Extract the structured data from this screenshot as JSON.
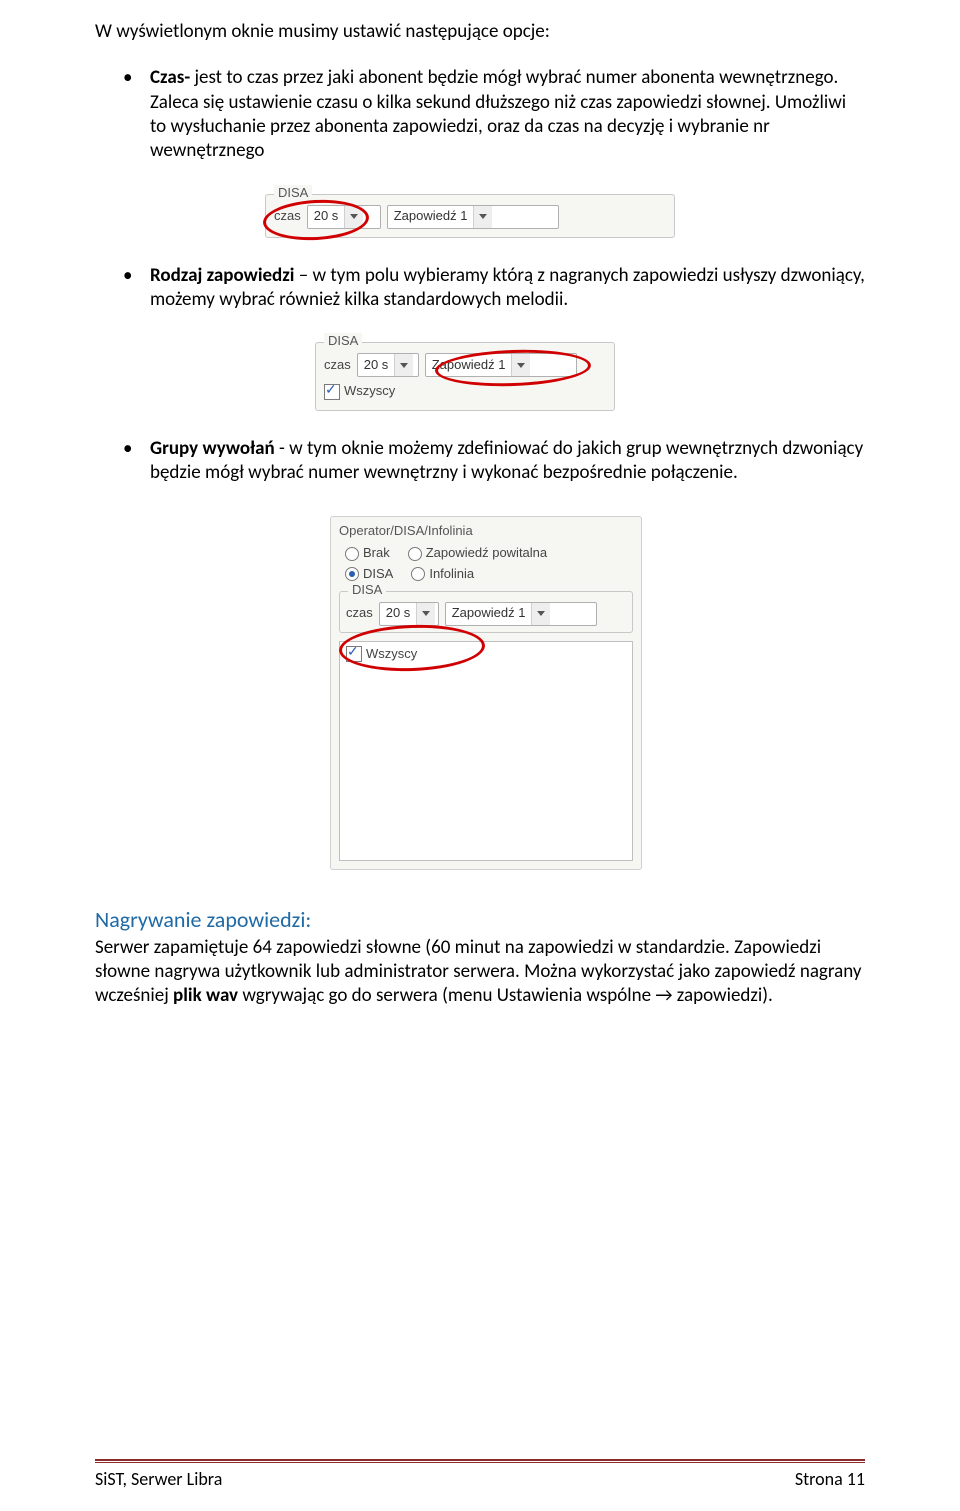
{
  "intro": "W wyświetlonym oknie musimy ustawić następujące opcje:",
  "bullet1": {
    "lead": "Czas-",
    "text": " jest to czas przez jaki abonent będzie mógł wybrać numer abonenta wewnętrznego. Zaleca się ustawienie czasu o kilka sekund dłuższego niż czas zapowiedzi słownej. Umożliwi to wysłuchanie  przez abonenta zapowiedzi, oraz da czas na decyzję i wybranie nr wewnętrznego"
  },
  "bullet2": {
    "lead": "Rodzaj zapowiedzi",
    "text": " – w tym polu wybieramy którą z nagranych zapowiedzi usłyszy dzwoniący, możemy wybrać również kilka standardowych melodii."
  },
  "bullet3": {
    "lead": "Grupy wywołań",
    "text": " -  w tym oknie możemy zdefiniować do jakich grup wewnętrznych dzwoniący będzie mógł wybrać numer wewnętrzny i wykonać bezpośrednie połączenie."
  },
  "shots": {
    "disa_legend": "DISA",
    "czas_label": "czas",
    "czas_value": "20 s",
    "zap_value": "Zapowiedź 1",
    "wszyscy_label": "Wszyscy",
    "operator_title": "Operator/DISA/Infolinia",
    "radio_brak": "Brak",
    "radio_zap_powitalna": "Zapowiedź powitalna",
    "radio_disa": "DISA",
    "radio_infolinia": "Infolinia"
  },
  "recording": {
    "heading": "Nagrywanie zapowiedzi:",
    "p1a": "Serwer zapamiętuje 64 zapowiedzi słowne (60 minut na zapowiedzi w standardzie. Zapowiedzi słowne nagrywa użytkownik lub administrator serwera. Można wykorzystać jako zapowiedź nagrany wcześniej ",
    "p1bold": "plik wav",
    "p1b": " wgrywając go do serwera (menu Ustawienia wspólne → zapowiedzi)."
  },
  "footer": {
    "left": "SiST, Serwer Libra",
    "right": "Strona 11"
  }
}
